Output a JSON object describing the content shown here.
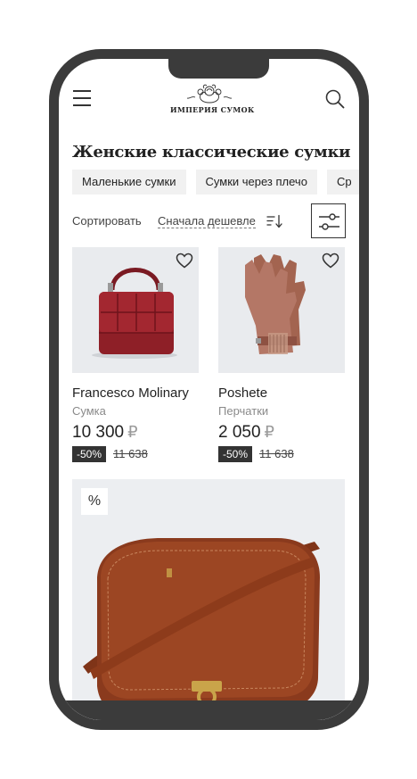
{
  "header": {
    "logo_text": "ИМПЕРИЯ СУМОК"
  },
  "page_title": "Женские классические сумки",
  "chips": [
    "Маленькие сумки",
    "Сумки через плечо",
    "Ср"
  ],
  "sort": {
    "label": "Сортировать",
    "value": "Сначала дешевле"
  },
  "products": [
    {
      "brand": "Francesco Molinary",
      "category": "Сумка",
      "price": "10 300",
      "currency": "₽",
      "discount": "-50%",
      "old_price": "11 638"
    },
    {
      "brand": "Poshete",
      "category": "Перчатки",
      "price": "2 050",
      "currency": "₽",
      "discount": "-50%",
      "old_price": "11 638"
    }
  ],
  "promo": {
    "badge": "%"
  },
  "colors": {
    "frame": "#3b3b3b",
    "chip_bg": "#f1f1f1",
    "badge_bg": "#333333",
    "bag_red": "#8e1f27",
    "gloves_brown": "#a86a58",
    "leather_bag": "#8a3a1d"
  }
}
